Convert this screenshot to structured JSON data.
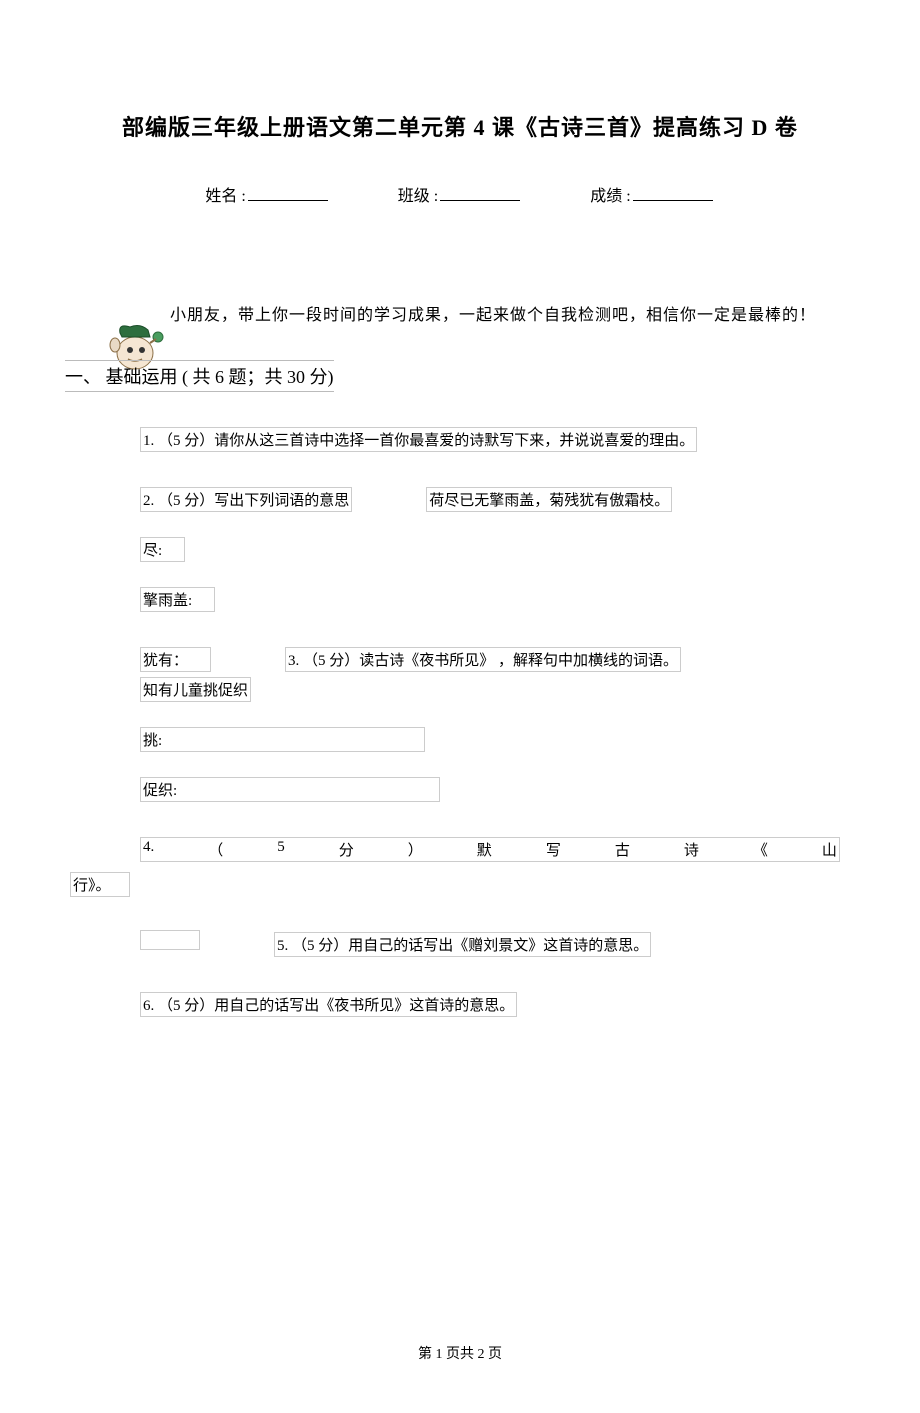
{
  "title": "部编版三年级上册语文第二单元第 4 课《古诗三首》提高练习 D 卷",
  "info": {
    "name_label": "姓名 :",
    "class_label": "班级 :",
    "score_label": "成绩 :"
  },
  "intro": "小朋友，带上你一段时间的学习成果，一起来做个自我检测吧，相信你一定是最棒的！",
  "section1": {
    "header": "一、  基础运用 ( 共 6 题；共 30 分)"
  },
  "q1": "1.   （5 分）请你从这三首诗中选择一首你最喜爱的诗默写下来，并说说喜爱的理由。",
  "q2": "2.   （5 分）写出下列词语的意思",
  "q2_sentence": "荷尽已无擎雨盖，菊残犹有傲霜枝。",
  "q2_word1": "尽:",
  "q2_word2": "擎雨盖:",
  "q2_word3": "犹有：",
  "q3": "3.   （5 分）读古诗《夜书所见》  ，解释句中加横线的词语。",
  "q3_sentence": "知有儿童挑促织",
  "q3_word1": "挑:",
  "q3_word2": "促织:",
  "q4_chars": [
    "4.",
    "（",
    "5",
    "分",
    "）",
    "默",
    "写",
    "古",
    "诗",
    "《",
    "山"
  ],
  "q4_part2": "行》。",
  "q5": "5.   （5 分）用自己的话写出《赠刘景文》这首诗的意思。",
  "q6": "6.   （5 分）用自己的话写出《夜书所见》这首诗的意思。",
  "footer": "第    1 页共 2 页"
}
